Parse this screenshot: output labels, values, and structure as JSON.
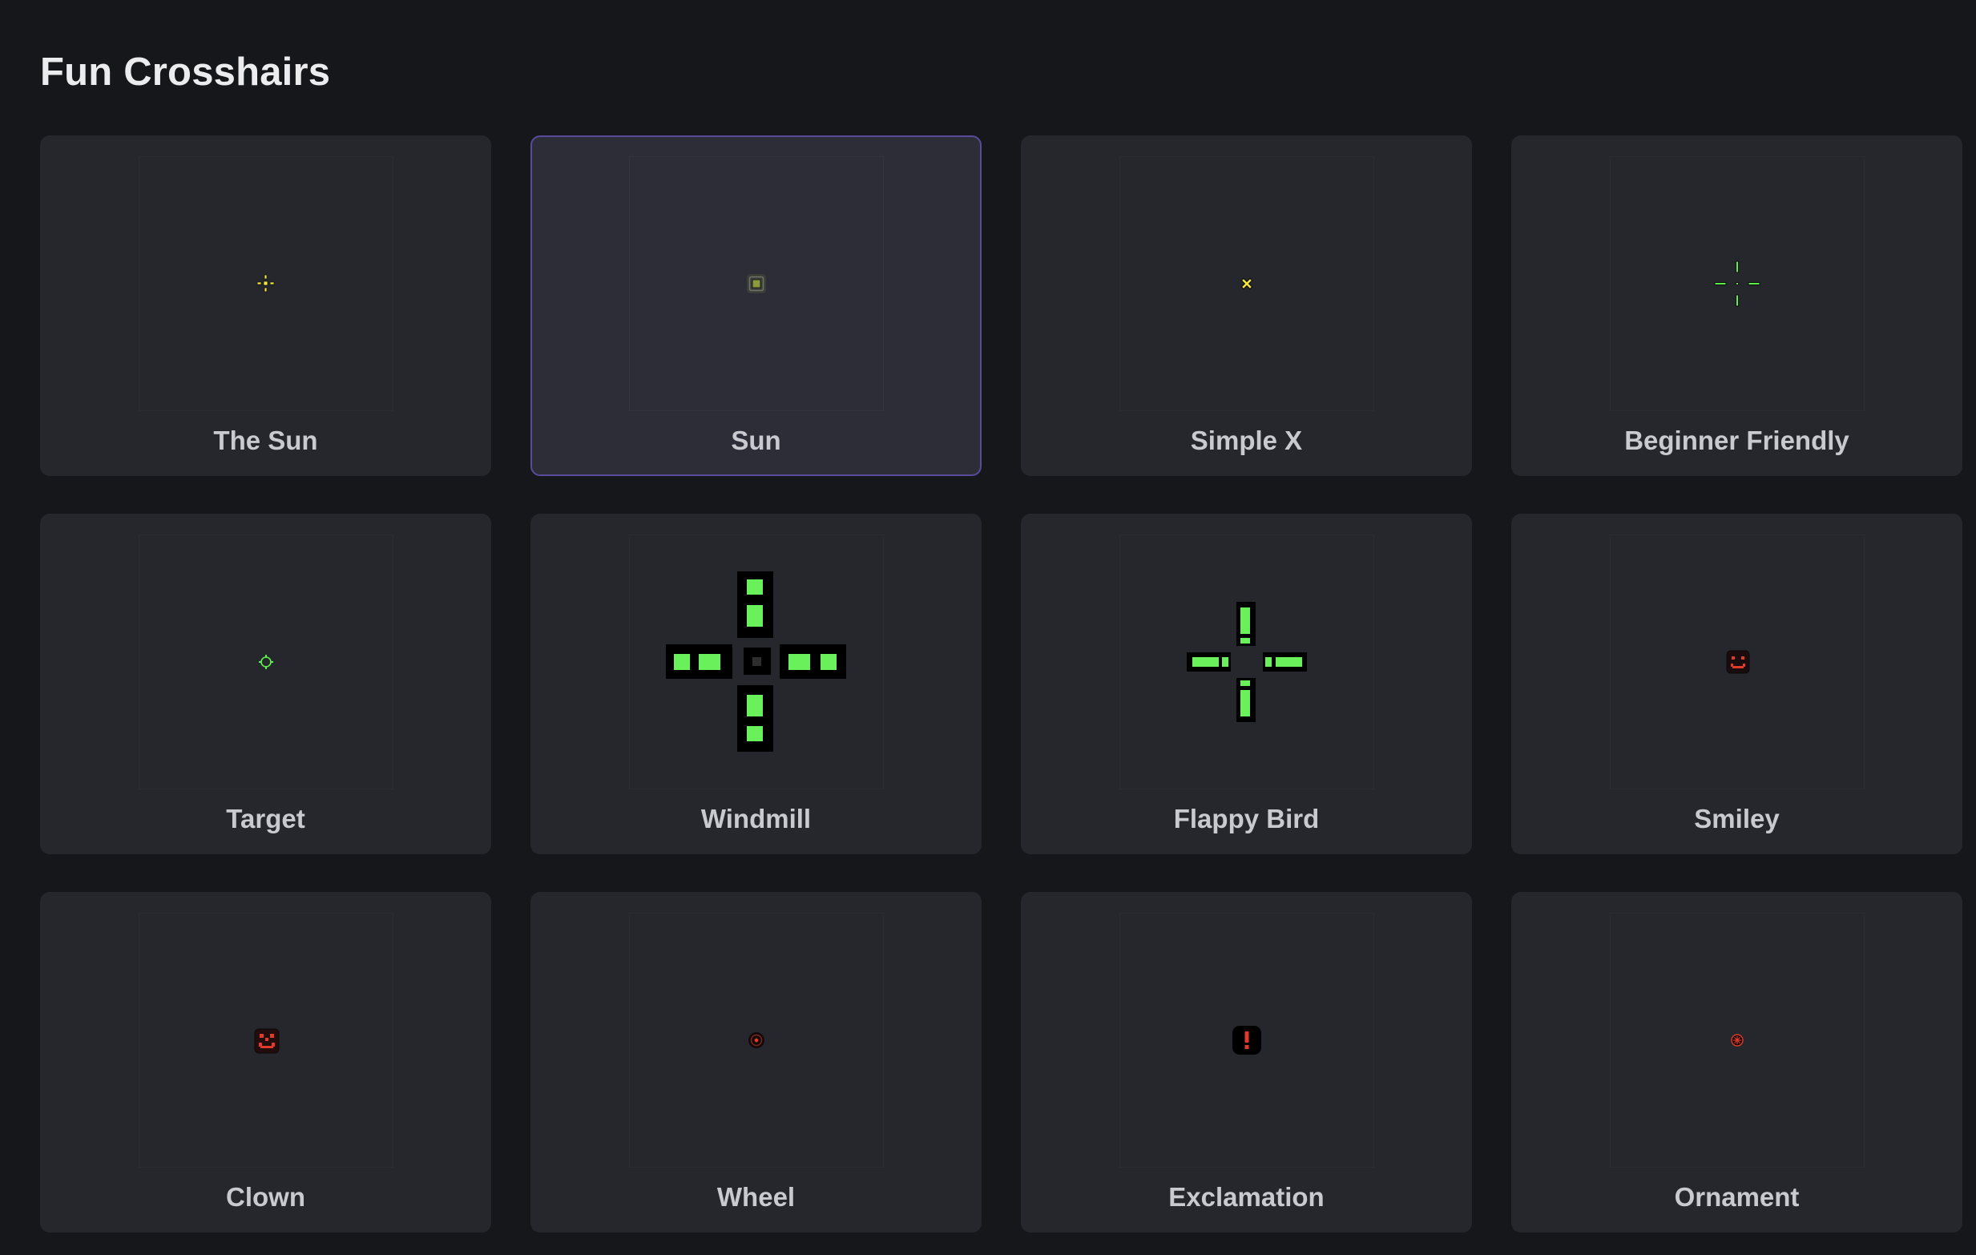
{
  "header": {
    "title": "Fun Crosshairs"
  },
  "crosshairs": [
    {
      "name": "The Sun",
      "icon": "sun-dot-icon",
      "color": "#f2e83a",
      "selected": false
    },
    {
      "name": "Sun",
      "icon": "square-dot-icon",
      "color": "#8c9a3c",
      "selected": true
    },
    {
      "name": "Simple X",
      "icon": "x-icon",
      "color": "#f2e83a",
      "selected": false
    },
    {
      "name": "Beginner Friendly",
      "icon": "gap-cross-icon",
      "color": "#5cf04a",
      "selected": false
    },
    {
      "name": "Target",
      "icon": "target-circle-icon",
      "color": "#5cf04a",
      "selected": false
    },
    {
      "name": "Windmill",
      "icon": "windmill-icon",
      "color": "#6af05a",
      "selected": false
    },
    {
      "name": "Flappy Bird",
      "icon": "flappy-cross-icon",
      "color": "#6af05a",
      "selected": false
    },
    {
      "name": "Smiley",
      "icon": "smiley-icon",
      "color": "#e03a2a",
      "selected": false
    },
    {
      "name": "Clown",
      "icon": "clown-icon",
      "color": "#e03a2a",
      "selected": false
    },
    {
      "name": "Wheel",
      "icon": "wheel-icon",
      "color": "#e03a2a",
      "selected": false
    },
    {
      "name": "Exclamation",
      "icon": "exclamation-icon",
      "color": "#e03a2a",
      "selected": false
    },
    {
      "name": "Ornament",
      "icon": "ornament-icon",
      "color": "#e03a2a",
      "selected": false
    }
  ]
}
